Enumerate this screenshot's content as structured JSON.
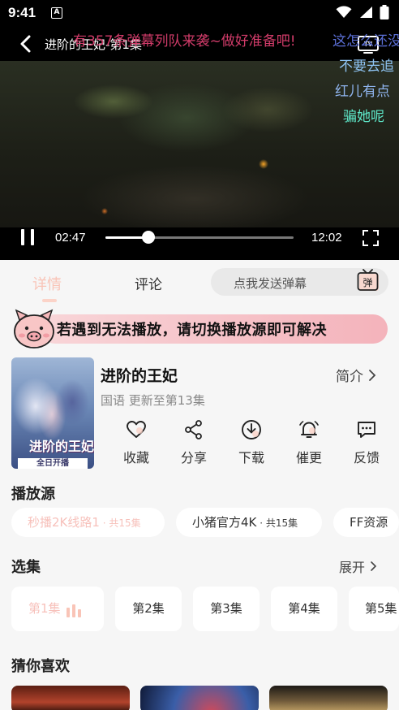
{
  "status_bar": {
    "time": "9:41",
    "notification_icon": "A"
  },
  "player": {
    "title": "进阶的王妃-第1集",
    "current_time": "02:47",
    "total_time": "12:02",
    "progress": 0.23,
    "danmu": [
      "有357条弹幕列队来袭~做好准备吧!",
      "这怎么还没",
      "不要去追",
      "红儿有点",
      "骗她呢"
    ]
  },
  "tabs": {
    "details": "详情",
    "comments": "评论"
  },
  "danmu_input": {
    "placeholder": "点我发送弹幕",
    "send_icon_label": "弹"
  },
  "notice": {
    "text": "若遇到无法播放，请切换播放源即可解决"
  },
  "show": {
    "title": "进阶的王妃",
    "meta": "国语 更新至第13集",
    "intro_label": "简介",
    "poster_title": "进阶的王妃",
    "poster_tag": "全日开播"
  },
  "actions": [
    {
      "label": "收藏",
      "icon": "heart-icon"
    },
    {
      "label": "分享",
      "icon": "share-icon"
    },
    {
      "label": "下载",
      "icon": "download-icon"
    },
    {
      "label": "催更",
      "icon": "bell-icon"
    },
    {
      "label": "反馈",
      "icon": "feedback-icon"
    }
  ],
  "sources": {
    "title": "播放源",
    "items": [
      {
        "name": "秒播2K线路1",
        "count": " · 共15集"
      },
      {
        "name": "小猪官方4K",
        "count": " · 共15集"
      },
      {
        "name": "FF资源",
        "count": ""
      }
    ]
  },
  "episodes": {
    "title": "选集",
    "expand_label": "展开",
    "items": [
      "第1集",
      "第2集",
      "第3集",
      "第4集",
      "第5集"
    ]
  },
  "recommendations": {
    "title": "猜你喜欢"
  },
  "colors": {
    "accent": "#f7c1bb",
    "notice_bg": "#f4b3bb",
    "danmu_red": "#d23c6a",
    "danmu_blue": "#5b6fd6",
    "danmu_green": "#5ee8c9"
  }
}
